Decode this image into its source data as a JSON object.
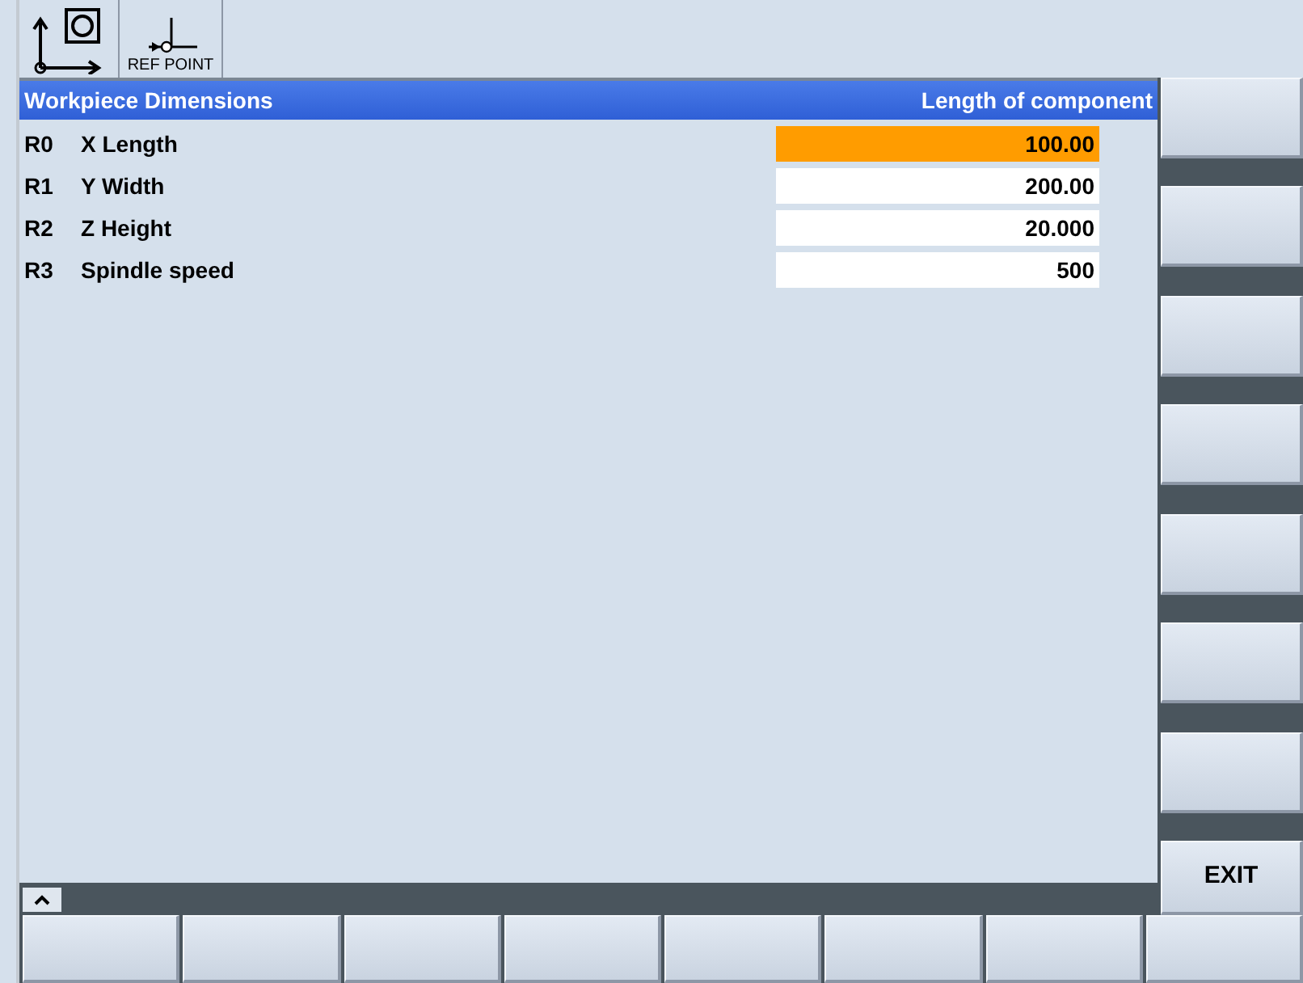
{
  "toolbar": {
    "ref_point_label": "REF POINT"
  },
  "panel": {
    "title": "Workpiece Dimensions",
    "hint": "Length of component",
    "parameters": [
      {
        "index": "R0",
        "label": "X Length",
        "value": "100.00",
        "selected": true
      },
      {
        "index": "R1",
        "label": "Y Width",
        "value": "200.00",
        "selected": false
      },
      {
        "index": "R2",
        "label": "Z Height",
        "value": "20.000",
        "selected": false
      },
      {
        "index": "R3",
        "label": "Spindle speed",
        "value": "500",
        "selected": false
      }
    ]
  },
  "exit_softkey": {
    "label": "EXIT"
  }
}
